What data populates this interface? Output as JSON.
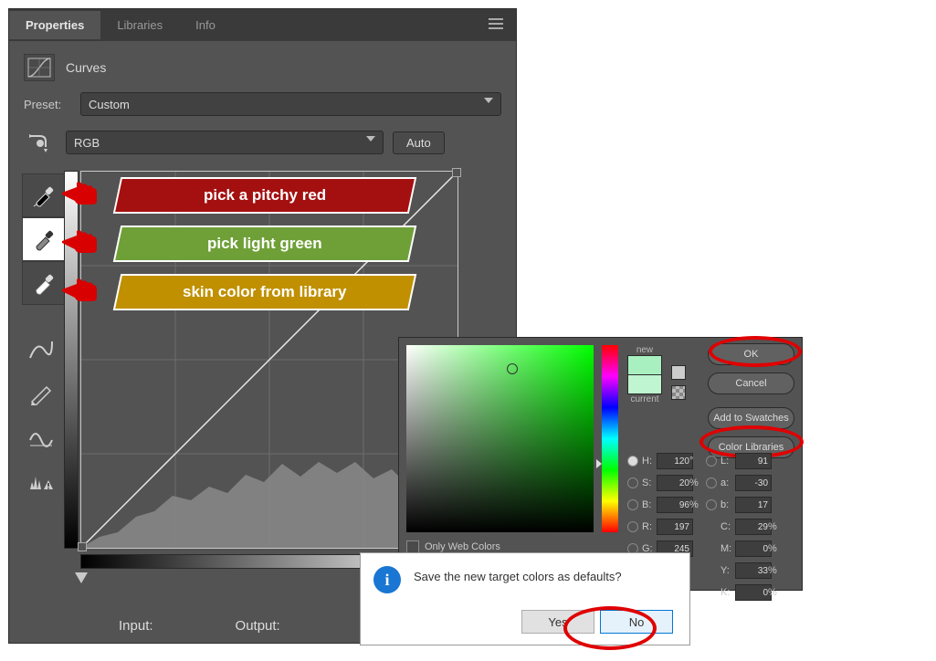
{
  "panel": {
    "tabs": [
      "Properties",
      "Libraries",
      "Info"
    ],
    "active_tab": "Properties",
    "adjustment": "Curves",
    "preset_label": "Preset:",
    "preset_value": "Custom",
    "channel_value": "RGB",
    "auto_label": "Auto",
    "input_label": "Input:",
    "output_label": "Output:"
  },
  "annotations": {
    "a1": "pick a pitchy red",
    "a2": "pick light green",
    "a3": "skin color from library"
  },
  "picker": {
    "new_label": "new",
    "current_label": "current",
    "buttons": {
      "ok": "OK",
      "cancel": "Cancel",
      "add": "Add to Swatches",
      "lib": "Color Libraries"
    },
    "owc": "Only Web Colors",
    "H": {
      "label": "H:",
      "val": "120",
      "unit": "°"
    },
    "S": {
      "label": "S:",
      "val": "20",
      "unit": "%"
    },
    "Bv": {
      "label": "B:",
      "val": "96",
      "unit": "%"
    },
    "R": {
      "label": "R:",
      "val": "197"
    },
    "G": {
      "label": "G:",
      "val": "245"
    },
    "L": {
      "label": "L:",
      "val": "91"
    },
    "a": {
      "label": "a:",
      "val": "-30"
    },
    "b": {
      "label": "b:",
      "val": "17"
    },
    "C": {
      "label": "C:",
      "val": "29",
      "unit": "%"
    },
    "M": {
      "label": "M:",
      "val": "0",
      "unit": "%"
    },
    "Y": {
      "label": "Y:",
      "val": "33",
      "unit": "%"
    },
    "K": {
      "label": "K:",
      "val": "0",
      "unit": "%"
    }
  },
  "dialog": {
    "message": "Save the new target colors as defaults?",
    "yes": "Yes",
    "no": "No"
  }
}
